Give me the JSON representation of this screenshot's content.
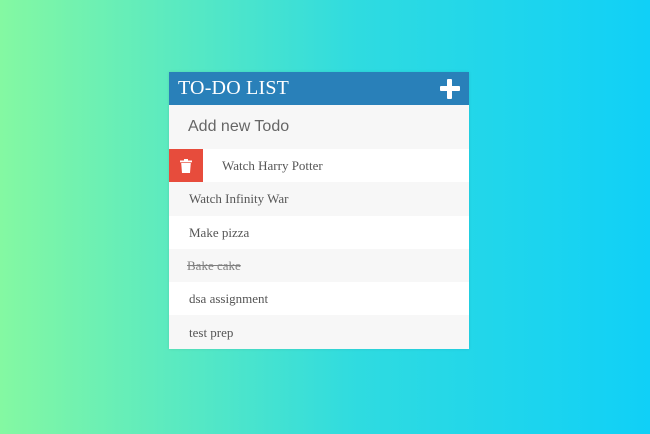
{
  "app": {
    "title": "TO-DO LIST"
  },
  "input": {
    "placeholder": "Add new Todo",
    "value": ""
  },
  "icons": {
    "add": "plus-icon",
    "delete": "trash-icon"
  },
  "colors": {
    "header": "#2980b9",
    "delete": "#e74c3c"
  },
  "todos": [
    {
      "text": "Watch Harry Potter",
      "completed": false,
      "hovered": true
    },
    {
      "text": "Watch Infinity War",
      "completed": false,
      "hovered": false
    },
    {
      "text": "Make pizza",
      "completed": false,
      "hovered": false
    },
    {
      "text": "Bake cake",
      "completed": true,
      "hovered": false
    },
    {
      "text": "dsa assignment",
      "completed": false,
      "hovered": false
    },
    {
      "text": "test prep",
      "completed": false,
      "hovered": false
    }
  ]
}
